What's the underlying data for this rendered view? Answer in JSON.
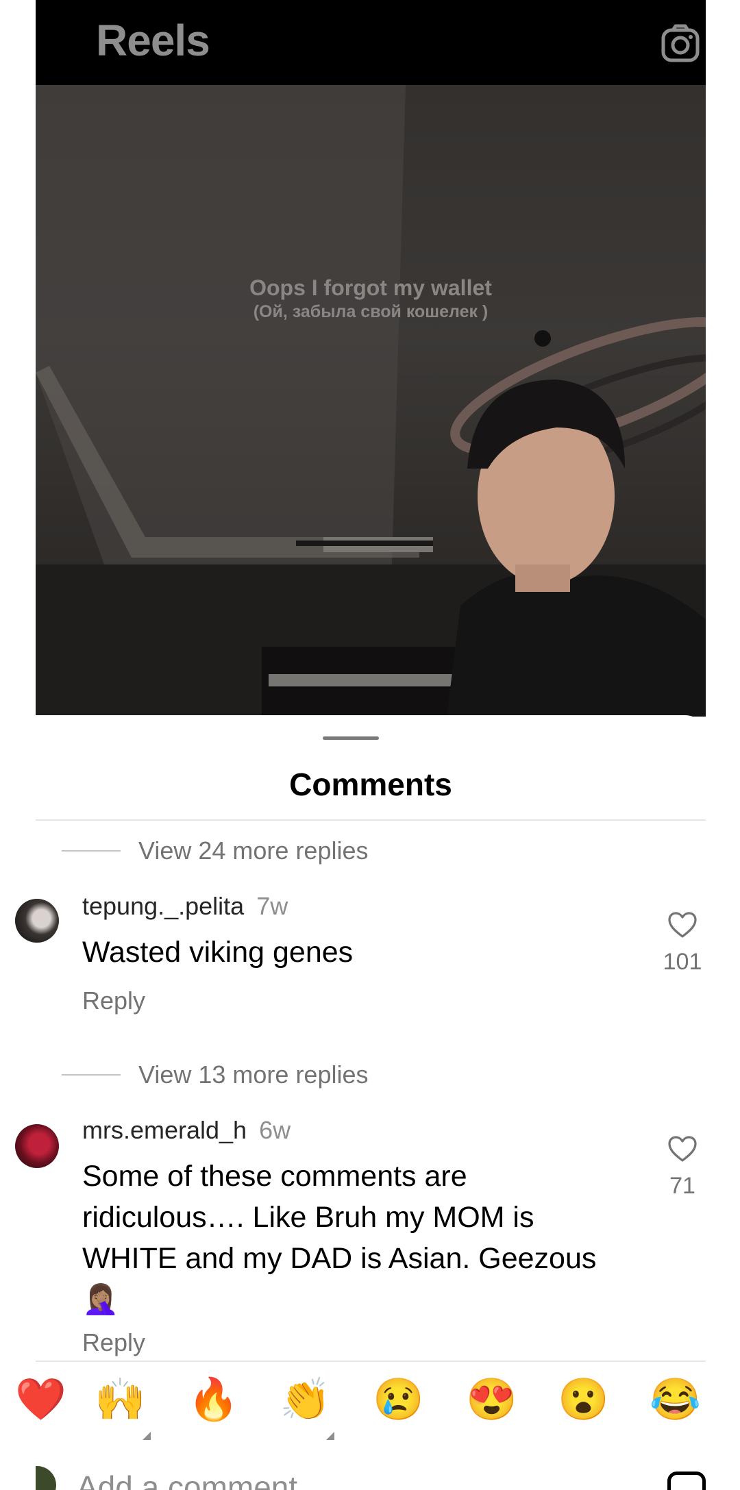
{
  "header": {
    "title": "Reels",
    "camera_icon": "camera-icon"
  },
  "video": {
    "caption_line1": "Oops I forgot my wallet",
    "caption_line2": "(Ой, забыла свой кошелек )"
  },
  "comments_sheet": {
    "title": "Comments",
    "top_replies": "View 24 more replies",
    "comments": [
      {
        "username": "tepung._.pelita",
        "time": "7w",
        "text": "Wasted viking genes",
        "reply_label": "Reply",
        "likes": "101",
        "more_replies": "View 13 more replies"
      },
      {
        "username": "mrs.emerald_h",
        "time": "6w",
        "text": "Some of these comments are ridiculous…. Like Bruh my MOM is WHITE and my DAD is Asian. Geezous 🤦🏽‍♀️",
        "reply_label": "Reply",
        "likes": "71"
      }
    ]
  },
  "quick_reactions": [
    "❤️",
    "🙌",
    "🔥",
    "👏",
    "😢",
    "😍",
    "😮",
    "😂"
  ],
  "composer": {
    "placeholder": "Add a comment…"
  },
  "colors": {
    "background": "#ffffff",
    "topbar": "#000000",
    "secondary_text": "#737373",
    "primary_text": "#000000"
  }
}
